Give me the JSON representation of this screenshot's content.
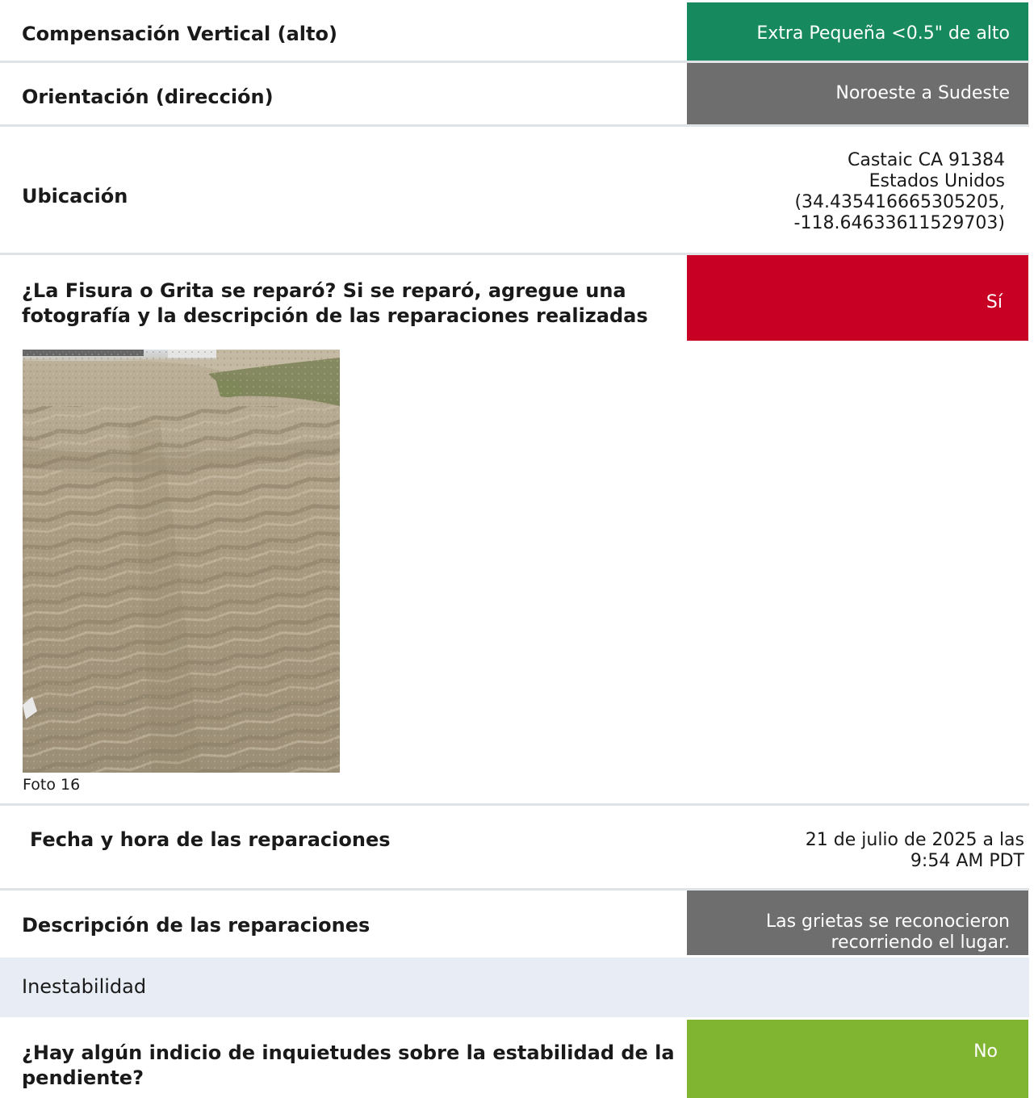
{
  "rows": {
    "vertical_offset": {
      "label": "Compensación Vertical (alto)",
      "value": "Extra Pequeña <0.5\" de alto",
      "color": "#168a5e"
    },
    "orientation": {
      "label": "Orientación (dirección)",
      "value": "Noroeste a Sudeste",
      "color": "#6e6e6e"
    },
    "location": {
      "label": "Ubicación",
      "lines": [
        "Castaic CA 91384",
        "Estados Unidos",
        "(34.435416665305205,",
        "-118.64633611529703)"
      ]
    },
    "repaired": {
      "label_lines": [
        "¿La Fisura o Grita se reparó? Si se reparó, agregue una",
        "fotografía y la descripción de las reparaciones realizadas"
      ],
      "value": "Sí",
      "color": "#c70024",
      "photo_caption": "Foto 16"
    },
    "repair_datetime": {
      "label": "Fecha y hora de las reparaciones",
      "lines": [
        "21 de julio de 2025 a las",
        "9:54 AM PDT"
      ]
    },
    "repair_description": {
      "label": "Descripción de las reparaciones",
      "lines": [
        "Las grietas se reconocieron",
        "recorriendo el lugar."
      ],
      "color": "#6e6e6e"
    }
  },
  "instability_section": {
    "title": "Inestabilidad",
    "slope_question": {
      "label_lines": [
        "¿Hay algún indicio de inquietudes sobre la estabilidad de la",
        "pendiente?"
      ],
      "value": "No",
      "color": "#80b531"
    }
  },
  "colors": {
    "divider": "#dfe3e8",
    "section_band": "#e8edf5"
  }
}
